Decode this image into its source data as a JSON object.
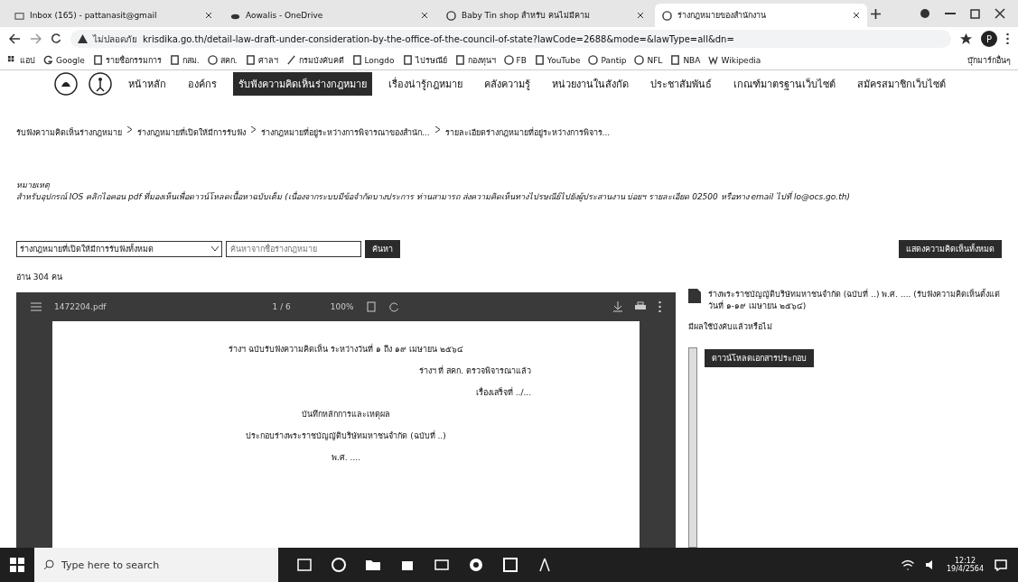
{
  "browser": {
    "tabs": [
      {
        "title": "Inbox (165) - pattanasit@gmail",
        "selected": false
      },
      {
        "title": "Aowalis - OneDrive",
        "selected": false
      },
      {
        "title": "Baby Tin shop สำหรับ คนไม่มีคาม",
        "selected": false
      },
      {
        "title": "ร่างกฎหมายของสำนักงาน",
        "selected": true
      }
    ],
    "security_label": "ไม่ปลอดภัย",
    "url": "krisdika.go.th/detail-law-draft-under-consideration-by-the-office-of-the-council-of-state?lawCode=2688&mode=&lawType=all&dn=",
    "profile_letter": "P",
    "bookmarks": [
      "แอป",
      "Google",
      "รายชื่อกรรมการ",
      "กสม.",
      "สคก.",
      "ศาลฯ",
      "กรมบังคับคดี",
      "Longdo",
      "ไปรษณีย์",
      "กองทุนฯ",
      "FB",
      "YouTube",
      "Pantip",
      "NFL",
      "NBA",
      "Wikipedia"
    ],
    "other_bookmarks": "บุ๊กมาร์กอื่นๆ"
  },
  "site_nav": [
    {
      "label": "หน้าหลัก",
      "selected": false
    },
    {
      "label": "องค์กร",
      "selected": false
    },
    {
      "label": "รับฟังความคิดเห็นร่างกฎหมาย",
      "selected": true
    },
    {
      "label": "เรื่องน่ารู้กฎหมาย",
      "selected": false
    },
    {
      "label": "คลังความรู้",
      "selected": false
    },
    {
      "label": "หน่วยงานในสังกัด",
      "selected": false
    },
    {
      "label": "ประชาสัมพันธ์",
      "selected": false
    },
    {
      "label": "เกณฑ์มาตรฐานเว็บไซต์",
      "selected": false
    },
    {
      "label": "สมัครสมาชิกเว็บไซต์",
      "selected": false
    }
  ],
  "breadcrumb": [
    "รับฟังความคิดเห็นร่างกฎหมาย",
    "ร่างกฎหมายที่เปิดให้มีการรับฟัง",
    "ร่างกฎหมายที่อยู่ระหว่างการพิจารณาของสำนัก...",
    "รายละเอียดร่างกฎหมายที่อยู่ระหว่างการพิจาร..."
  ],
  "note_title": "หมายเหตุ",
  "note": "สำหรับอุปกรณ์ IOS คลิกไอคอน pdf ที่มองเห็นเพื่อดาวน์โหลดเนื้อหาฉบับเต็ม (เนื่องจากระบบมีข้อจำกัดบางประการ ท่านสามารถ ส่งความคิดเห็นทางไปรษณีย์ไปยังผู้ประสานงาน บ่อยฯ รายละเอียด 02500 หรือทาง email ไปที่ lo@ocs.go.th)",
  "filter": {
    "select": "ร่างกฎหมายที่เปิดให้มีการรับฟังทั้งหมด",
    "placeholder": "ค้นหาจากชื่อร่างกฎหมาย",
    "button": "ค้นหา"
  },
  "all_opinions_button": "แสดงความคิดเห็นทั้งหมด",
  "readers": "อ่าน 304 คน",
  "viewer": {
    "file": "1472204.pdf",
    "page": "1 / 6",
    "zoom": "100%",
    "lines": [
      {
        "text": "ร่างฯ ฉบับรับฟังความคิดเห็น ระหว่างวันที่ ๑ ถึง ๑๙ เมษายน ๒๕๖๔",
        "kind": "heading"
      },
      {
        "text": "ร่างฯ ที่ สคก. ตรวจพิจารณาแล้ว",
        "kind": "reference"
      },
      {
        "text": "เรื่องเสร็จที่ ../...",
        "kind": "reference"
      },
      {
        "text": "บันทึกหลักการและเหตุผล",
        "kind": "heading"
      },
      {
        "text": "ประกอบร่างพระราชบัญญัติบริษัทมหาชนจำกัด (ฉบับที่ ..)",
        "kind": "heading"
      },
      {
        "text": "พ.ศ. ....",
        "kind": "heading"
      }
    ]
  },
  "side": {
    "title": "ร่างพระราชบัญญัติบริษัทมหาชนจำกัด (ฉบับที่ ..) พ.ศ. .... (รับฟังความคิดเห็นตั้งแต่วันที่ ๑-๑๙ เมษายน ๒๕๖๔)",
    "subtitle": "มีผลใช้บังคับแล้วหรือไม่",
    "button": "ดาวน์โหลดเอกสารประกอบ"
  },
  "taskbar": {
    "search_placeholder": "Type here to search",
    "time": "12:12",
    "date": "19/4/2564"
  }
}
